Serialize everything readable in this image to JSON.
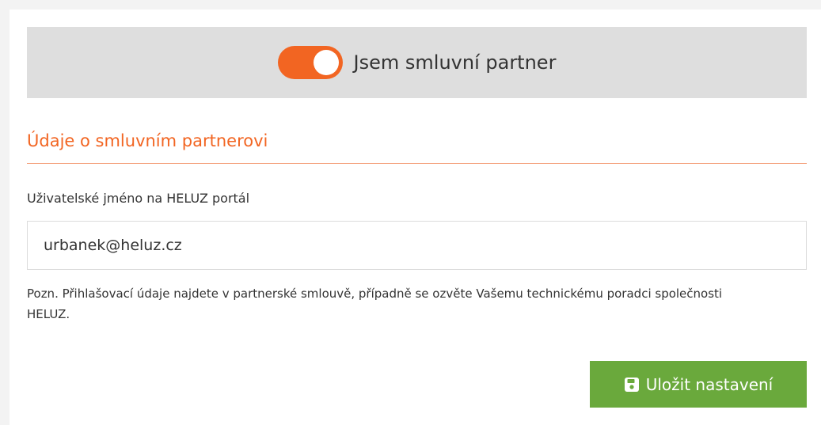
{
  "toggle": {
    "label": "Jsem smluvní partner",
    "checked": true,
    "on_color": "#f26522"
  },
  "section": {
    "title": "Údaje o smluvním partnerovi",
    "accent_color": "#f26522"
  },
  "username_field": {
    "label": "Uživatelské jméno na HELUZ portál",
    "value": "urbanek@heluz.cz"
  },
  "note": {
    "text": "Pozn. Přihlašovací údaje najdete v partnerské smlouvě, případně se ozvěte Vašemu technickému poradci společnosti HELUZ."
  },
  "save_button": {
    "label": "Uložit nastavení",
    "icon": "floppy-disk-icon",
    "color": "#6aa93c"
  }
}
